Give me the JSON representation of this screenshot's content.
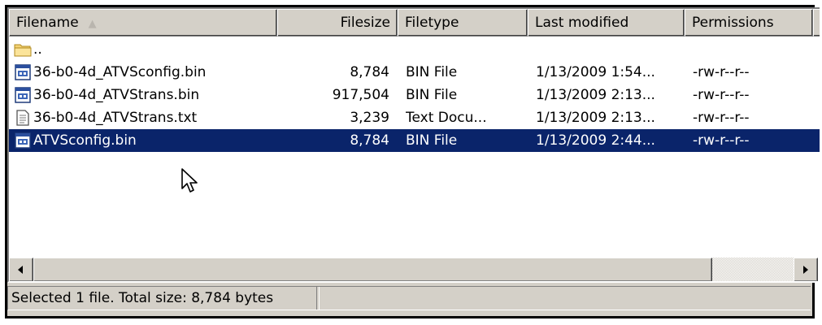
{
  "columns": [
    {
      "label": "Filename",
      "name": "col-filename",
      "align": "left"
    },
    {
      "label": "Filesize",
      "name": "col-filesize",
      "align": "right"
    },
    {
      "label": "Filetype",
      "name": "col-filetype",
      "align": "left"
    },
    {
      "label": "Last modified",
      "name": "col-last-modified",
      "align": "left"
    },
    {
      "label": "Permissions",
      "name": "col-permissions",
      "align": "left"
    }
  ],
  "sort_indicator": "▲",
  "rows": [
    {
      "icon": "parent-folder-icon",
      "name": "..",
      "size": "",
      "type": "",
      "modified": "",
      "perms": "",
      "selected": false
    },
    {
      "icon": "binary-file-icon",
      "name": "36-b0-4d_ATVSconfig.bin",
      "size": "8,784",
      "type": "BIN File",
      "modified": "1/13/2009 1:54...",
      "perms": "-rw-r--r--",
      "selected": false
    },
    {
      "icon": "binary-file-icon",
      "name": "36-b0-4d_ATVStrans.bin",
      "size": "917,504",
      "type": "BIN File",
      "modified": "1/13/2009 2:13...",
      "perms": "-rw-r--r--",
      "selected": false
    },
    {
      "icon": "text-file-icon",
      "name": "36-b0-4d_ATVStrans.txt",
      "size": "3,239",
      "type": "Text Docu...",
      "modified": "1/13/2009 2:13...",
      "perms": "-rw-r--r--",
      "selected": false
    },
    {
      "icon": "binary-file-icon",
      "name": "ATVSconfig.bin",
      "size": "8,784",
      "type": "BIN File",
      "modified": "1/13/2009 2:44...",
      "perms": "-rw-r--r--",
      "selected": true
    }
  ],
  "status": {
    "text": "Selected 1 file. Total size: 8,784 bytes"
  },
  "colors": {
    "selection": "#0a246a",
    "chrome": "#d4d0c8"
  }
}
